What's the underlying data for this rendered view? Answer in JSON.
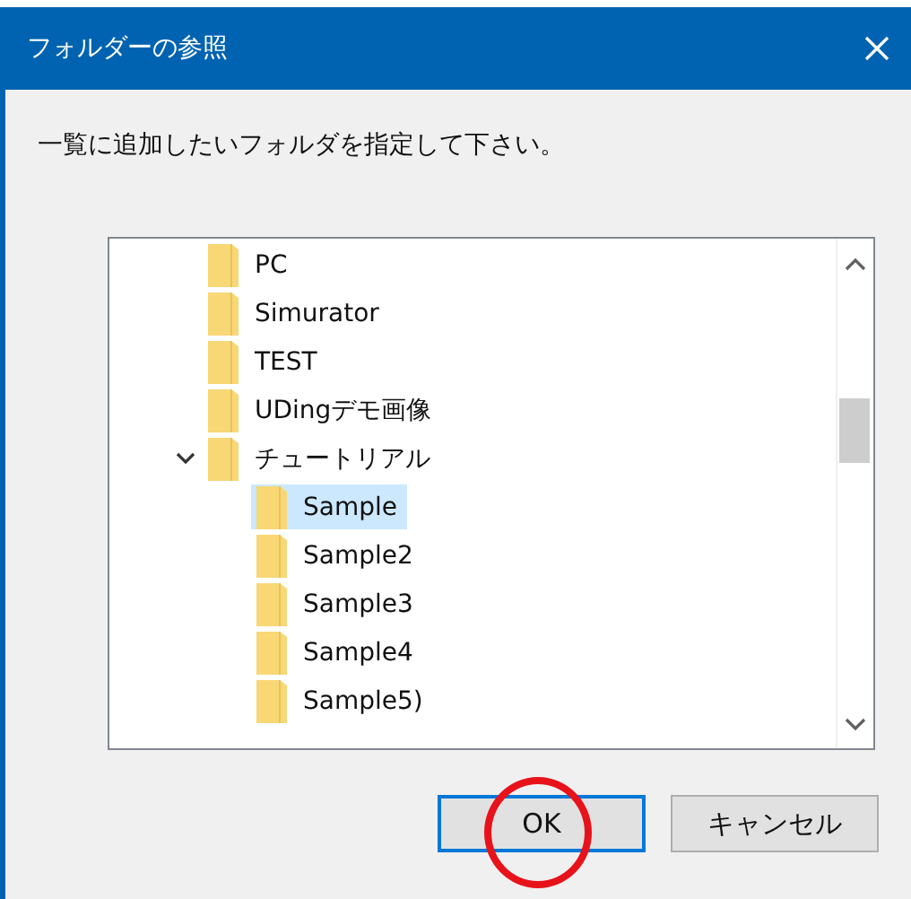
{
  "window": {
    "title": "フォルダーの参照"
  },
  "instruction": "一覧に追加したいフォルダを指定して下さい。",
  "tree": [
    {
      "label": "PC",
      "selected": false
    },
    {
      "label": "Simurator",
      "selected": false
    },
    {
      "label": "TEST",
      "selected": false
    },
    {
      "label": "UDingデモ画像",
      "selected": false
    },
    {
      "label": "チュートリアル",
      "selected": false,
      "expanded": true,
      "children": [
        {
          "label": "Sample",
          "selected": true
        },
        {
          "label": "Sample2",
          "selected": false
        },
        {
          "label": "Sample3",
          "selected": false
        },
        {
          "label": "Sample4",
          "selected": false
        },
        {
          "label": "Sample5)",
          "selected": false
        }
      ]
    }
  ],
  "buttons": [
    {
      "label": "OK",
      "default": true
    },
    {
      "label": "キャンセル",
      "default": false
    }
  ]
}
